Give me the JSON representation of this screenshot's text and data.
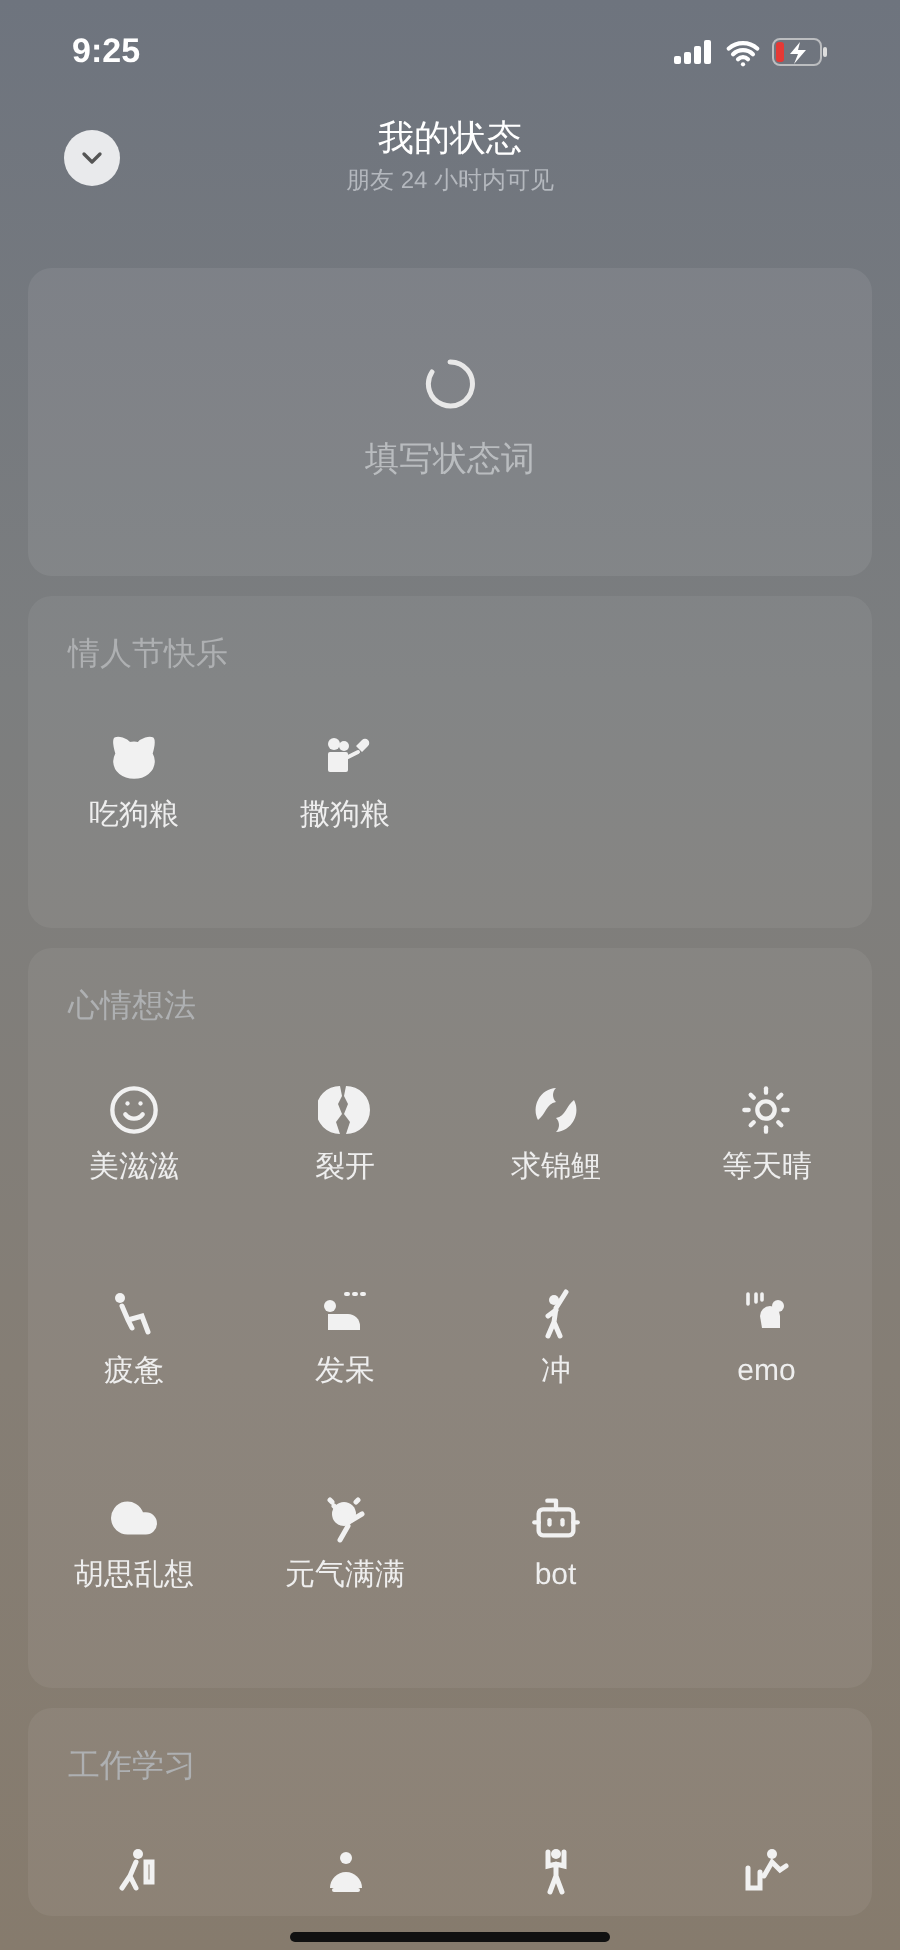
{
  "status_bar": {
    "time": "9:25"
  },
  "header": {
    "title": "我的状态",
    "subtitle": "朋友 24 小时内可见"
  },
  "status_input": {
    "placeholder": "填写状态词"
  },
  "sections": [
    {
      "title": "情人节快乐",
      "items": [
        {
          "label": "吃狗粮"
        },
        {
          "label": "撒狗粮"
        }
      ]
    },
    {
      "title": "心情想法",
      "items": [
        {
          "label": "美滋滋"
        },
        {
          "label": "裂开"
        },
        {
          "label": "求锦鲤"
        },
        {
          "label": "等天晴"
        },
        {
          "label": "疲惫"
        },
        {
          "label": "发呆"
        },
        {
          "label": "冲"
        },
        {
          "label": "emo"
        },
        {
          "label": "胡思乱想"
        },
        {
          "label": "元气满满"
        },
        {
          "label": "bot"
        }
      ]
    },
    {
      "title": "工作学习",
      "items": [
        {
          "kind": "clipped"
        },
        {
          "kind": "clipped"
        },
        {
          "kind": "clipped"
        },
        {
          "kind": "clipped"
        }
      ]
    }
  ]
}
